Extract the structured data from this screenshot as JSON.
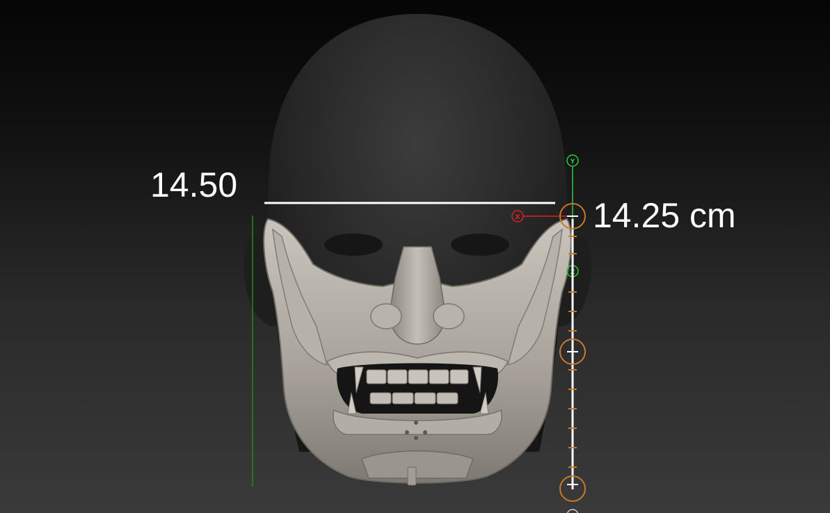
{
  "measurements": {
    "width_value": "14.50",
    "height_value": "14.25 cm"
  },
  "gizmo": {
    "y_axis_label": "Y",
    "x_axis_label": "X",
    "z_axis_label": "Z",
    "colors": {
      "y_axis": "#2ecc40",
      "x_axis": "#e02020",
      "handle": "#c87a2a",
      "ruler": "#ffffff",
      "guide": "#1f8a1f"
    }
  },
  "model": {
    "description_icon": "oni-mask-on-head-mesh-icon"
  }
}
